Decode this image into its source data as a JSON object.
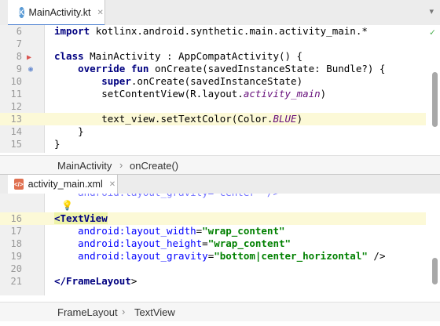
{
  "top_tab": {
    "label": "MainActivity.kt",
    "icon": "kotlin-file-icon"
  },
  "kotlin_editor": {
    "lines": [
      {
        "n": "6",
        "tokens": [
          [
            "kw",
            "import "
          ],
          [
            "",
            "kotlinx.android.synthetic.main.activity_main.*"
          ]
        ]
      },
      {
        "n": "7",
        "tokens": []
      },
      {
        "n": "8",
        "tokens": [
          [
            "kw",
            "class "
          ],
          [
            "",
            "MainActivity : AppCompatActivity() {"
          ]
        ]
      },
      {
        "n": "9",
        "tokens": [
          [
            "",
            "    "
          ],
          [
            "kw",
            "override fun "
          ],
          [
            "",
            "onCreate(savedInstanceState: Bundle?) {"
          ]
        ]
      },
      {
        "n": "10",
        "tokens": [
          [
            "",
            "        "
          ],
          [
            "kw",
            "super"
          ],
          [
            "",
            ".onCreate(savedInstanceState)"
          ]
        ]
      },
      {
        "n": "11",
        "tokens": [
          [
            "",
            "        setContentView(R.layout."
          ],
          [
            "it",
            "activity_main"
          ],
          [
            "",
            ")"
          ]
        ]
      },
      {
        "n": "12",
        "tokens": []
      },
      {
        "n": "13",
        "tokens": [
          [
            "",
            "        text_view.setTextColor(Color."
          ],
          [
            "it",
            "BLUE"
          ],
          [
            "",
            ")"
          ]
        ]
      },
      {
        "n": "14",
        "tokens": [
          [
            "",
            "    }"
          ]
        ]
      },
      {
        "n": "15",
        "tokens": [
          [
            "",
            "}"
          ]
        ]
      }
    ]
  },
  "kotlin_breadcrumb": {
    "item1": "MainActivity",
    "sep": "›",
    "item2": "onCreate()"
  },
  "bottom_tab": {
    "label": "activity_main.xml",
    "icon": "xml-file-icon"
  },
  "xml_editor": {
    "partial_line": "    android:layout_gravity=\"center\" />",
    "lines": [
      {
        "n": "16",
        "tokens": [
          [
            "tag",
            "<TextView"
          ]
        ]
      },
      {
        "n": "17",
        "tokens": [
          [
            "",
            "    "
          ],
          [
            "attr",
            "android:layout_width"
          ],
          [
            "",
            "="
          ],
          [
            "str",
            "\"wrap_content\""
          ]
        ]
      },
      {
        "n": "18",
        "tokens": [
          [
            "",
            "    "
          ],
          [
            "attr",
            "android:layout_height"
          ],
          [
            "",
            "="
          ],
          [
            "str",
            "\"wrap_content\""
          ]
        ]
      },
      {
        "n": "19",
        "tokens": [
          [
            "",
            "    "
          ],
          [
            "attr",
            "android:layout_gravity"
          ],
          [
            "",
            "="
          ],
          [
            "str",
            "\"bottom|center_horizontal\""
          ],
          [
            "",
            " />"
          ]
        ]
      },
      {
        "n": "20",
        "tokens": []
      },
      {
        "n": "21",
        "tokens": [
          [
            "tag",
            "</FrameLayout"
          ],
          [
            "",
            ">"
          ]
        ]
      }
    ]
  },
  "xml_breadcrumb": {
    "item1": "FrameLayout",
    "sep": "›",
    "item2": "TextView"
  },
  "colors": {
    "accent": "#4a7fd0",
    "highlight_line": "#fcf9d7",
    "ok_check": "#4caf50"
  }
}
